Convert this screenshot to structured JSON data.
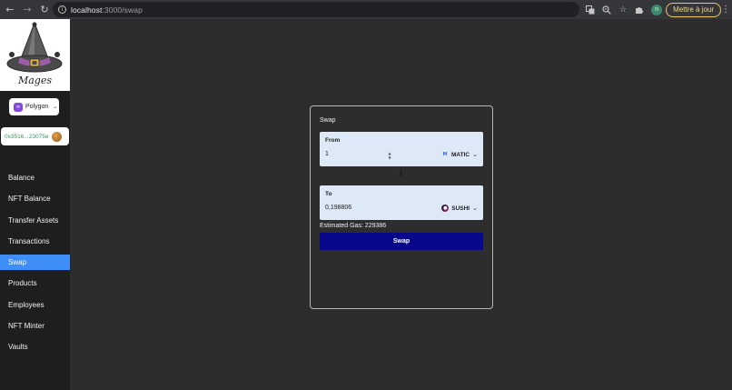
{
  "browser": {
    "url_host": "localhost",
    "url_path": ":3000/swap",
    "update_label": "Mettre à jour",
    "profile_initial": "n"
  },
  "sidebar": {
    "logo_text": "Mages",
    "network": "Polygon",
    "account": "0x3516...23075e",
    "items": [
      {
        "label": "Balance"
      },
      {
        "label": "NFT Balance"
      },
      {
        "label": "Transfer Assets"
      },
      {
        "label": "Transactions"
      },
      {
        "label": "Swap"
      },
      {
        "label": "Products"
      },
      {
        "label": "Employees"
      },
      {
        "label": "NFT Minter"
      },
      {
        "label": "Vaults"
      }
    ],
    "active_index": 4
  },
  "swap": {
    "title": "Swap",
    "from": {
      "label": "From",
      "value": "1",
      "token": "MATIC"
    },
    "to": {
      "label": "To",
      "value": "0,198806",
      "token": "SUSHI"
    },
    "gas_text": "Estimated Gas: 229386",
    "button_label": "Swap"
  },
  "colors": {
    "accent": "#3f8ef7",
    "swap_button": "#06078a",
    "field_bg": "#dde9f7",
    "account_text": "#2e9c5c"
  }
}
